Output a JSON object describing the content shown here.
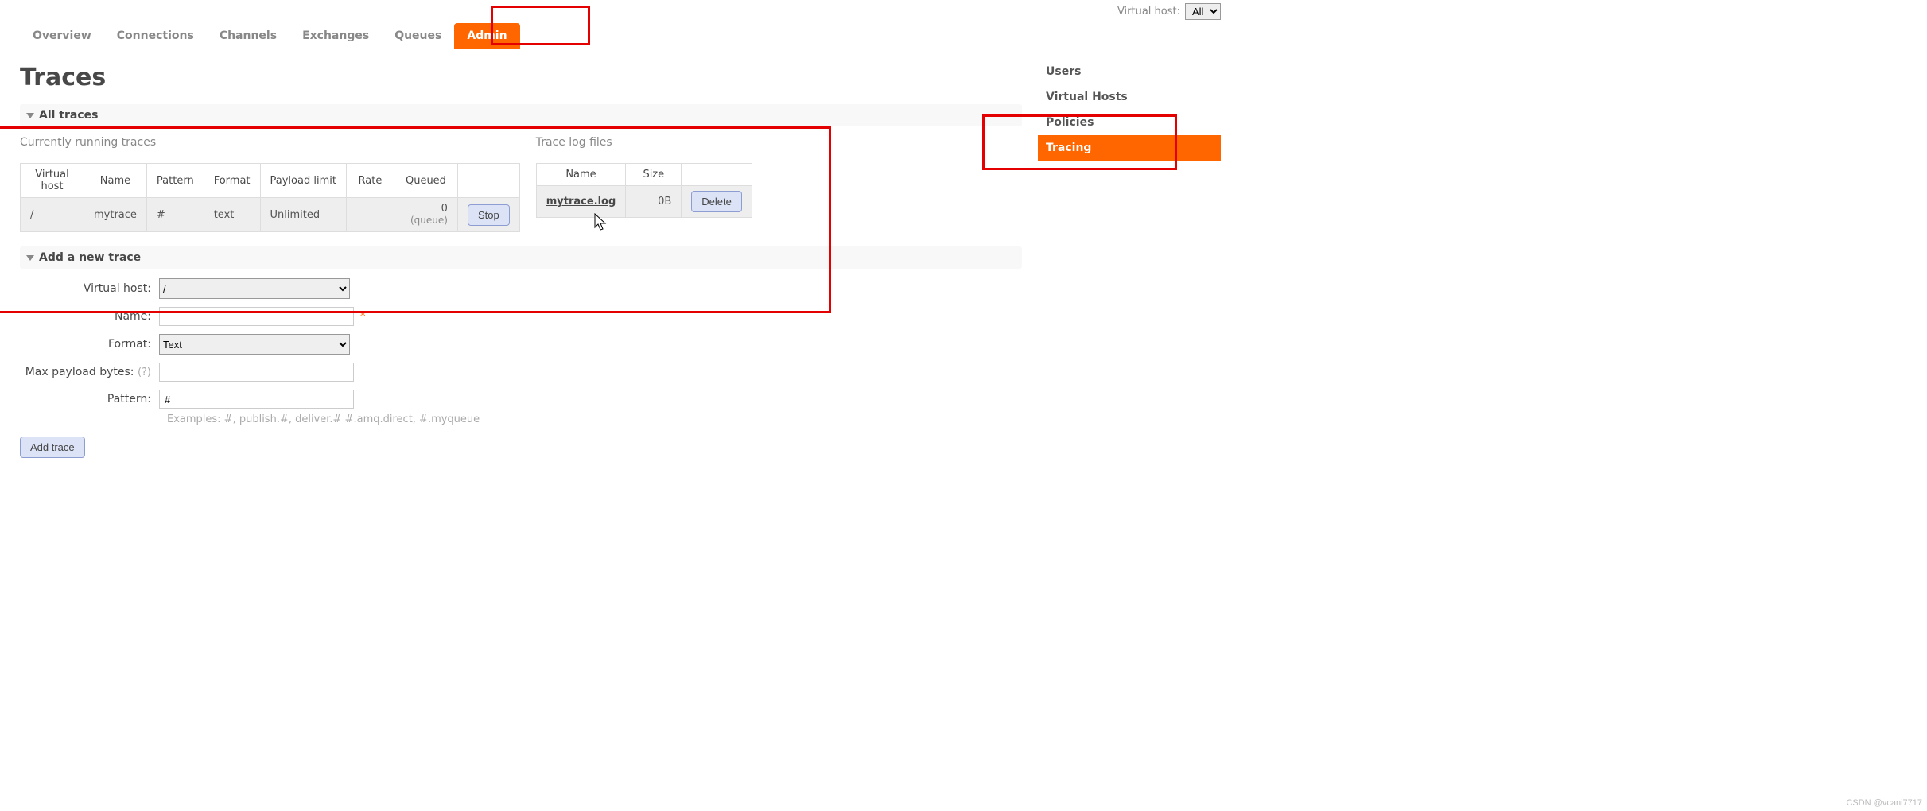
{
  "topbar": {
    "vhost_label": "Virtual host:",
    "vhost_selected": "All"
  },
  "tabs": [
    "Overview",
    "Connections",
    "Channels",
    "Exchanges",
    "Queues",
    "Admin"
  ],
  "active_tab": "Admin",
  "page_title": "Traces",
  "sidebar": {
    "items": [
      "Users",
      "Virtual Hosts",
      "Policies",
      "Tracing"
    ],
    "active": "Tracing"
  },
  "sections": {
    "all_traces": "All traces",
    "add_trace": "Add a new trace"
  },
  "running": {
    "heading": "Currently running traces",
    "columns": [
      "Virtual host",
      "Name",
      "Pattern",
      "Format",
      "Payload limit",
      "Rate",
      "Queued",
      ""
    ],
    "rows": [
      {
        "vhost": "/",
        "name": "mytrace",
        "pattern": "#",
        "format": "text",
        "payload": "Unlimited",
        "rate": "",
        "queued": "0",
        "queue_sub": "(queue)",
        "action": "Stop"
      }
    ]
  },
  "logs": {
    "heading": "Trace log files",
    "columns": [
      "Name",
      "Size",
      ""
    ],
    "rows": [
      {
        "name": "mytrace.log",
        "size": "0B",
        "action": "Delete"
      }
    ]
  },
  "form": {
    "vhost_label": "Virtual host:",
    "vhost_value": "/",
    "name_label": "Name:",
    "name_value": "",
    "format_label": "Format:",
    "format_value": "Text",
    "maxpayload_label": "Max payload bytes:",
    "maxpayload_help": "(?)",
    "maxpayload_value": "",
    "pattern_label": "Pattern:",
    "pattern_value": "#",
    "pattern_hint": "Examples: #, publish.#, deliver.# #.amq.direct, #.myqueue",
    "submit": "Add trace"
  },
  "watermark": "CSDN @vcani7717"
}
